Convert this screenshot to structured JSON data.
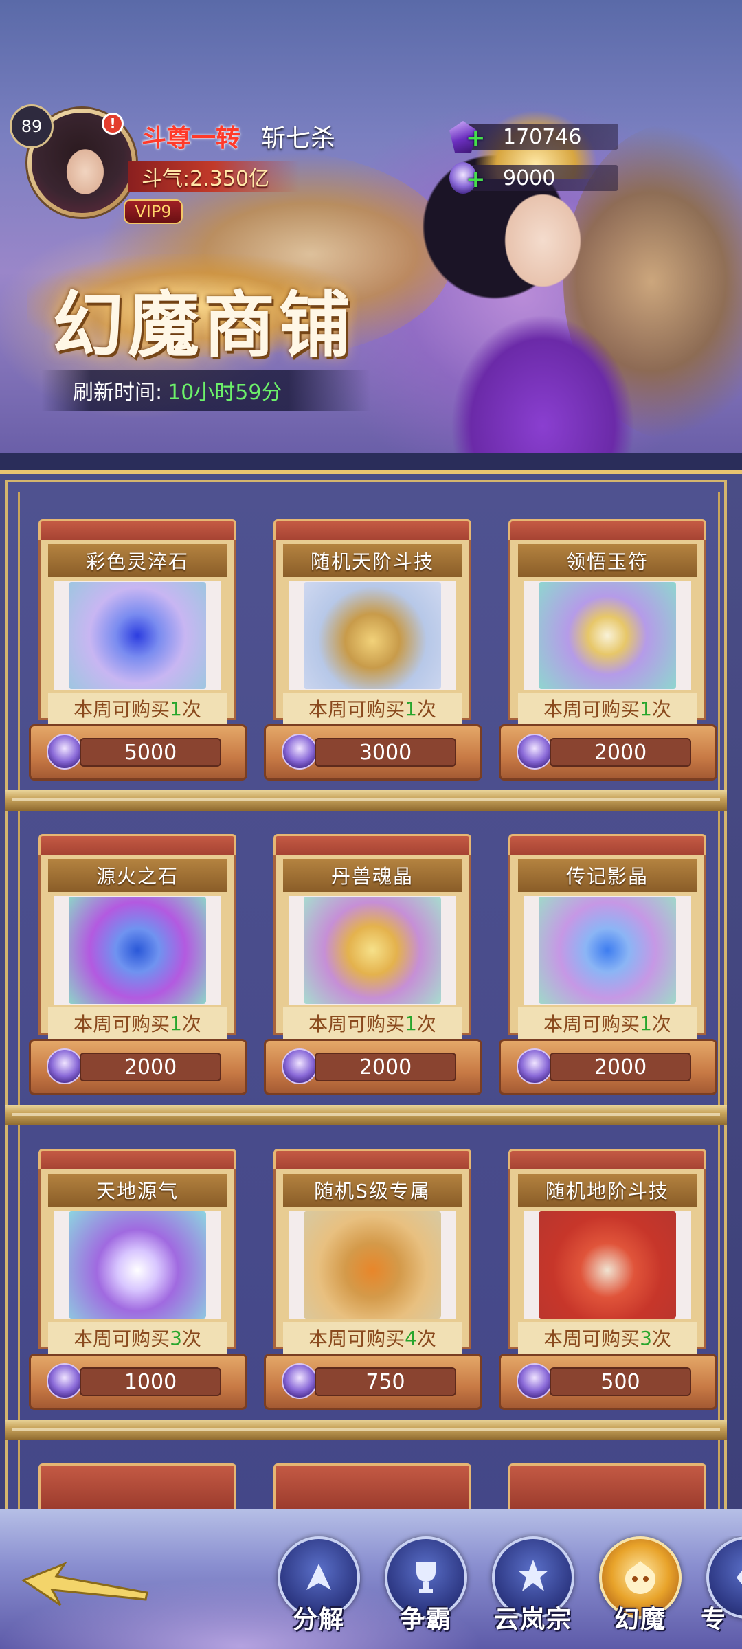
{
  "player": {
    "level": "89",
    "alert": "!",
    "rank": "斗尊一转",
    "name": "斩七杀",
    "power": "斗气:2.350亿",
    "vip": "VIP9"
  },
  "currencies": [
    {
      "icon": "purple-crystal-icon",
      "value": "170746"
    },
    {
      "icon": "phantom-coin-icon",
      "value": "9000"
    }
  ],
  "shop": {
    "title": "幻魔商铺",
    "refresh_label": "刷新时间:",
    "refresh_value": "10小时59分",
    "limit_prefix": "本周可购买",
    "limit_suffix": "次",
    "items": [
      {
        "name": "彩色灵淬石",
        "limit": "1",
        "price": "5000"
      },
      {
        "name": "随机天阶斗技",
        "limit": "1",
        "price": "3000"
      },
      {
        "name": "领悟玉符",
        "limit": "1",
        "price": "2000"
      },
      {
        "name": "源火之石",
        "limit": "1",
        "price": "2000"
      },
      {
        "name": "丹兽魂晶",
        "limit": "1",
        "price": "2000"
      },
      {
        "name": "传记影晶",
        "limit": "1",
        "price": "2000"
      },
      {
        "name": "天地源气",
        "limit": "3",
        "price": "1000"
      },
      {
        "name": "随机S级专属",
        "limit": "4",
        "price": "750"
      },
      {
        "name": "随机地阶斗技",
        "limit": "3",
        "price": "500"
      }
    ]
  },
  "nav": {
    "items": [
      {
        "label": "分解",
        "icon": "decompose-icon"
      },
      {
        "label": "争霸",
        "icon": "trophy-icon"
      },
      {
        "label": "云岚宗",
        "icon": "sect-icon"
      },
      {
        "label": "幻魔",
        "icon": "phantom-demon-icon"
      },
      {
        "label": "专",
        "icon": "exclusive-icon"
      }
    ]
  },
  "colors": {
    "accent_gold": "#e9c470",
    "limit_green": "#27a52c",
    "refresh_green": "#6cf06a",
    "rank_red": "#ff3a2a"
  }
}
